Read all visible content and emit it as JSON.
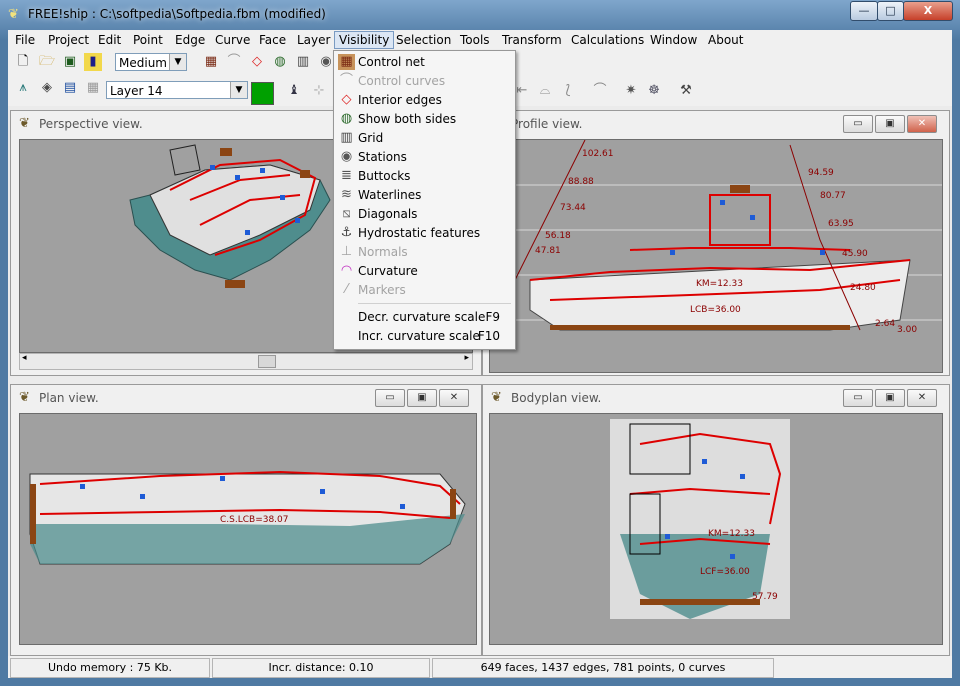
{
  "title": "FREE!ship    : C:\\softpedia\\Softpedia.fbm (modified)",
  "caption_buttons": {
    "minimize": "—",
    "maximize": "□",
    "close": "X"
  },
  "menubar": [
    "File",
    "Project",
    "Edit",
    "Point",
    "Face",
    "Curve",
    "Face",
    "Layer",
    "Visibility",
    "Selection",
    "Tools",
    "Transform",
    "Calculations",
    "Window",
    "About"
  ],
  "menu_labels": {
    "file": "File",
    "project": "Project",
    "edit": "Edit",
    "point": "Point",
    "edge": "Edge",
    "curve": "Curve",
    "face": "Face",
    "layer": "Layer",
    "visibility": "Visibility",
    "selection": "Selection",
    "tools": "Tools",
    "transform": "Transform",
    "calculations": "Calculations",
    "window": "Window",
    "about": "About"
  },
  "toolbar": {
    "precision_value": "Medium",
    "layer_value": "Layer 14",
    "layer_color": "#00a000"
  },
  "visibility_menu": [
    {
      "label": "Control net",
      "enabled": true,
      "icon": "control-net-icon"
    },
    {
      "label": "Control curves",
      "enabled": false,
      "icon": "control-curves-icon"
    },
    {
      "label": "Interior edges",
      "enabled": true,
      "icon": "interior-edges-icon"
    },
    {
      "label": "Show both sides",
      "enabled": true,
      "icon": "show-both-sides-icon"
    },
    {
      "label": "Grid",
      "enabled": true,
      "icon": "grid-icon"
    },
    {
      "label": "Stations",
      "enabled": true,
      "icon": "stations-icon"
    },
    {
      "label": "Buttocks",
      "enabled": true,
      "icon": "buttocks-icon"
    },
    {
      "label": "Waterlines",
      "enabled": true,
      "icon": "waterlines-icon"
    },
    {
      "label": "Diagonals",
      "enabled": true,
      "icon": "diagonals-icon"
    },
    {
      "label": "Hydrostatic features",
      "enabled": true,
      "icon": "hydrostatic-icon"
    },
    {
      "label": "Normals",
      "enabled": false,
      "icon": "normals-icon"
    },
    {
      "label": "Curvature",
      "enabled": true,
      "icon": "curvature-icon"
    },
    {
      "label": "Markers",
      "enabled": false,
      "icon": "markers-icon"
    }
  ],
  "curvature_items": [
    {
      "label": "Decr. curvature scale",
      "shortcut": "F9"
    },
    {
      "label": "Incr. curvature scale",
      "shortcut": "F10"
    }
  ],
  "views": {
    "perspective": "Perspective view.",
    "profile": "Profile view.",
    "plan": "Plan view.",
    "bodyplan": "Bodyplan view."
  },
  "profile_labels": [
    "102.61",
    "88.88",
    "73.44",
    "56.18",
    "47.81",
    "94.59",
    "80.77",
    "63.95",
    "45.90",
    "24.80",
    "2.64",
    "3.00",
    "KM=12.33",
    "LCB=36.00"
  ],
  "plan_labels": [
    "C.S.LCB=38.07"
  ],
  "bodyplan_labels": [
    "KM=12.33",
    "LCF=36.00",
    "57.79"
  ],
  "status": {
    "undo": "Undo memory : 75 Kb.",
    "incr": "Incr. distance: 0.10",
    "counts": "649 faces, 1437 edges, 781 points, 0 curves"
  }
}
